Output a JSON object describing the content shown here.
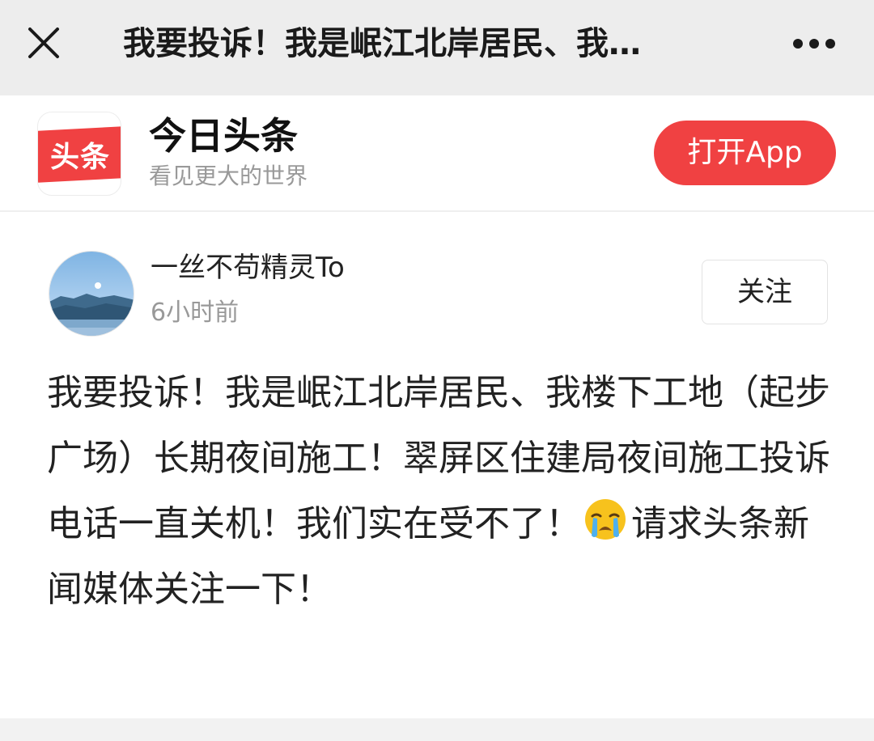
{
  "navbar": {
    "title": "我要投诉！我是岷江北岸居民、我…",
    "close_icon": "close-icon",
    "more_icon": "more-icon"
  },
  "banner": {
    "logo_text": "头条",
    "app_name": "今日头条",
    "slogan": "看见更大的世界",
    "open_app_label": "打开App",
    "accent_color": "#f04142"
  },
  "post": {
    "author": "一丝不苟精灵To",
    "time": "6小时前",
    "follow_label": "关注",
    "text_before_emoji": "我要投诉！我是岷江北岸居民、我楼下工地（起步广场）长期夜间施工！翠屏区住建局夜间施工投诉电话一直关机！我们实在受不了！",
    "emoji": "crying-face-emoji",
    "text_after_emoji": "请求头条新闻媒体关注一下！"
  }
}
